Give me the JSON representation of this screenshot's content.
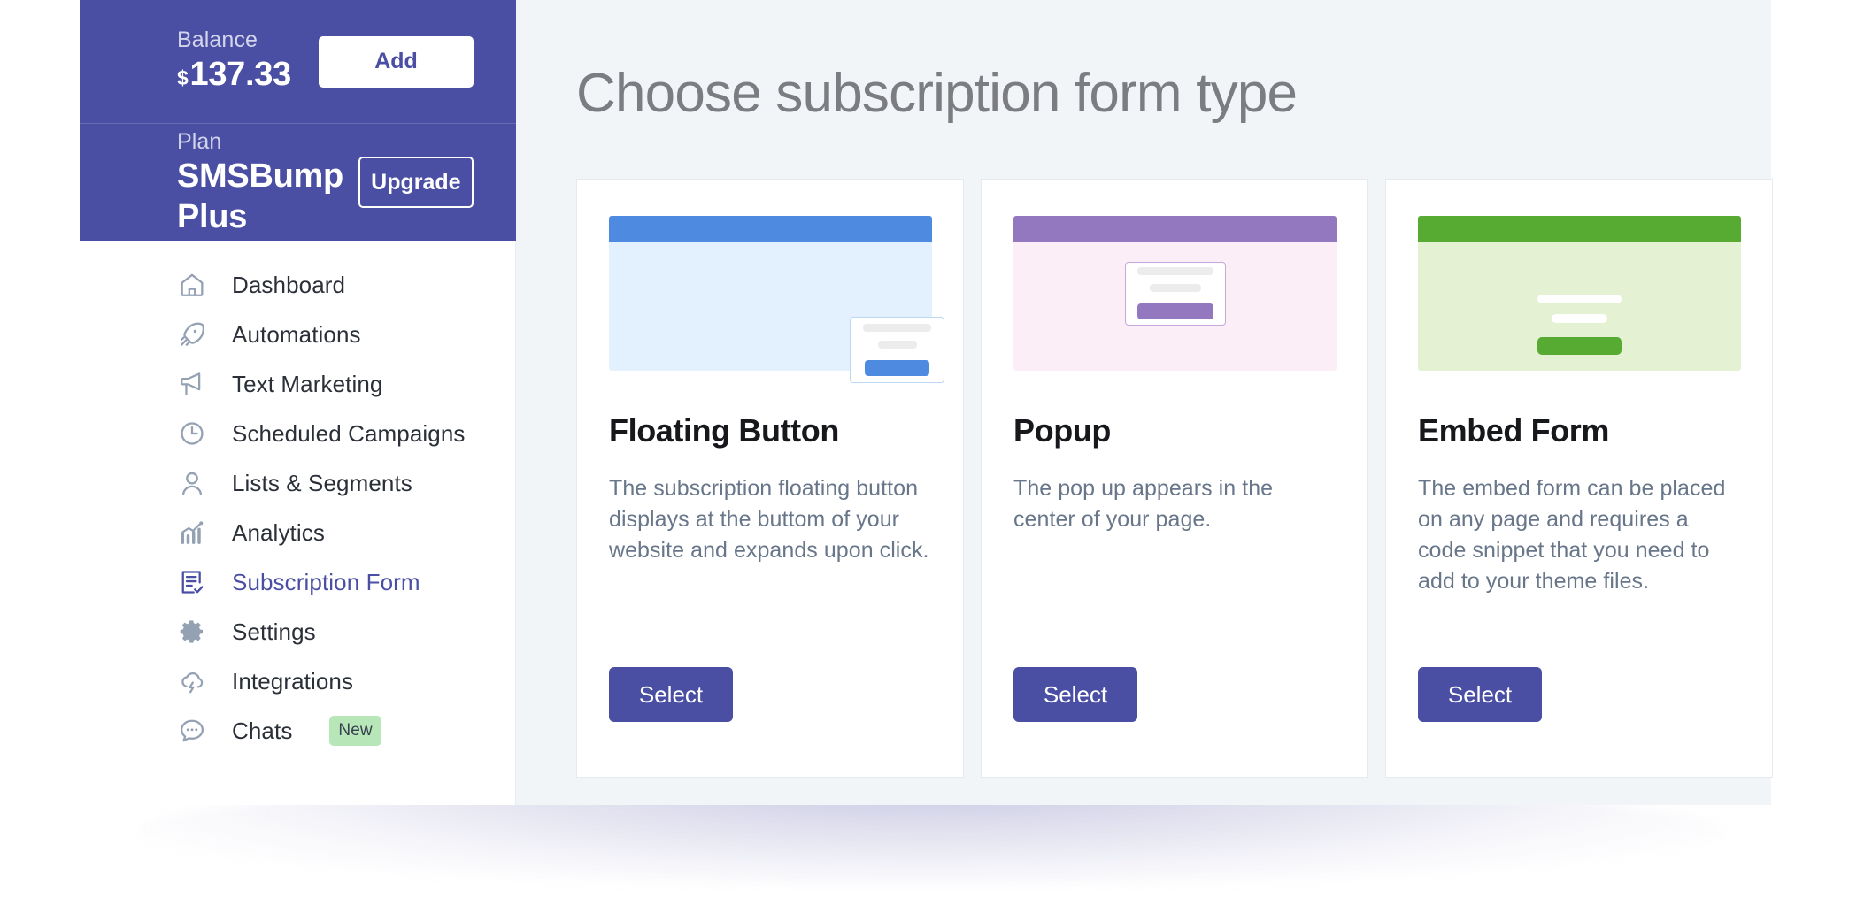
{
  "sidebar": {
    "balance": {
      "label": "Balance",
      "currency": "$",
      "amount": "137.33",
      "button": "Add"
    },
    "plan": {
      "label": "Plan",
      "name": "SMSBump Plus",
      "button": "Upgrade"
    },
    "nav_items": [
      {
        "label": "Dashboard",
        "icon": "home-icon",
        "active": false
      },
      {
        "label": "Automations",
        "icon": "rocket-icon",
        "active": false
      },
      {
        "label": "Text Marketing",
        "icon": "megaphone-icon",
        "active": false
      },
      {
        "label": "Scheduled Campaigns",
        "icon": "clock-icon",
        "active": false
      },
      {
        "label": "Lists & Segments",
        "icon": "user-icon",
        "active": false
      },
      {
        "label": "Analytics",
        "icon": "bar-chart-icon",
        "active": false
      },
      {
        "label": "Subscription Form",
        "icon": "form-check-icon",
        "active": true
      },
      {
        "label": "Settings",
        "icon": "gear-icon",
        "active": false
      },
      {
        "label": "Integrations",
        "icon": "cloud-lightning-icon",
        "active": false
      },
      {
        "label": "Chats",
        "icon": "chat-bubble-icon",
        "active": false,
        "badge": "New"
      }
    ]
  },
  "main": {
    "title": "Choose subscription form type",
    "cards": [
      {
        "title": "Floating Button",
        "description": "The subscription floating button displays at the buttom of your website and expands upon click.",
        "select_label": "Select",
        "accent": "#4e8ae0",
        "surface": "#e3f0fd"
      },
      {
        "title": "Popup",
        "description": "The pop up appears in the center of your page.",
        "select_label": "Select",
        "accent": "#9478bf",
        "surface": "#fceef6"
      },
      {
        "title": "Embed Form",
        "description": "The embed form can be placed on any page and requires a code snippet that you need to add to your theme files.",
        "select_label": "Select",
        "accent": "#57ab33",
        "surface": "#e4f2d3"
      }
    ]
  },
  "colors": {
    "brand": "#4a4fa3",
    "badge_new_bg": "#b7e6b9",
    "main_bg": "#f2f5f8"
  }
}
